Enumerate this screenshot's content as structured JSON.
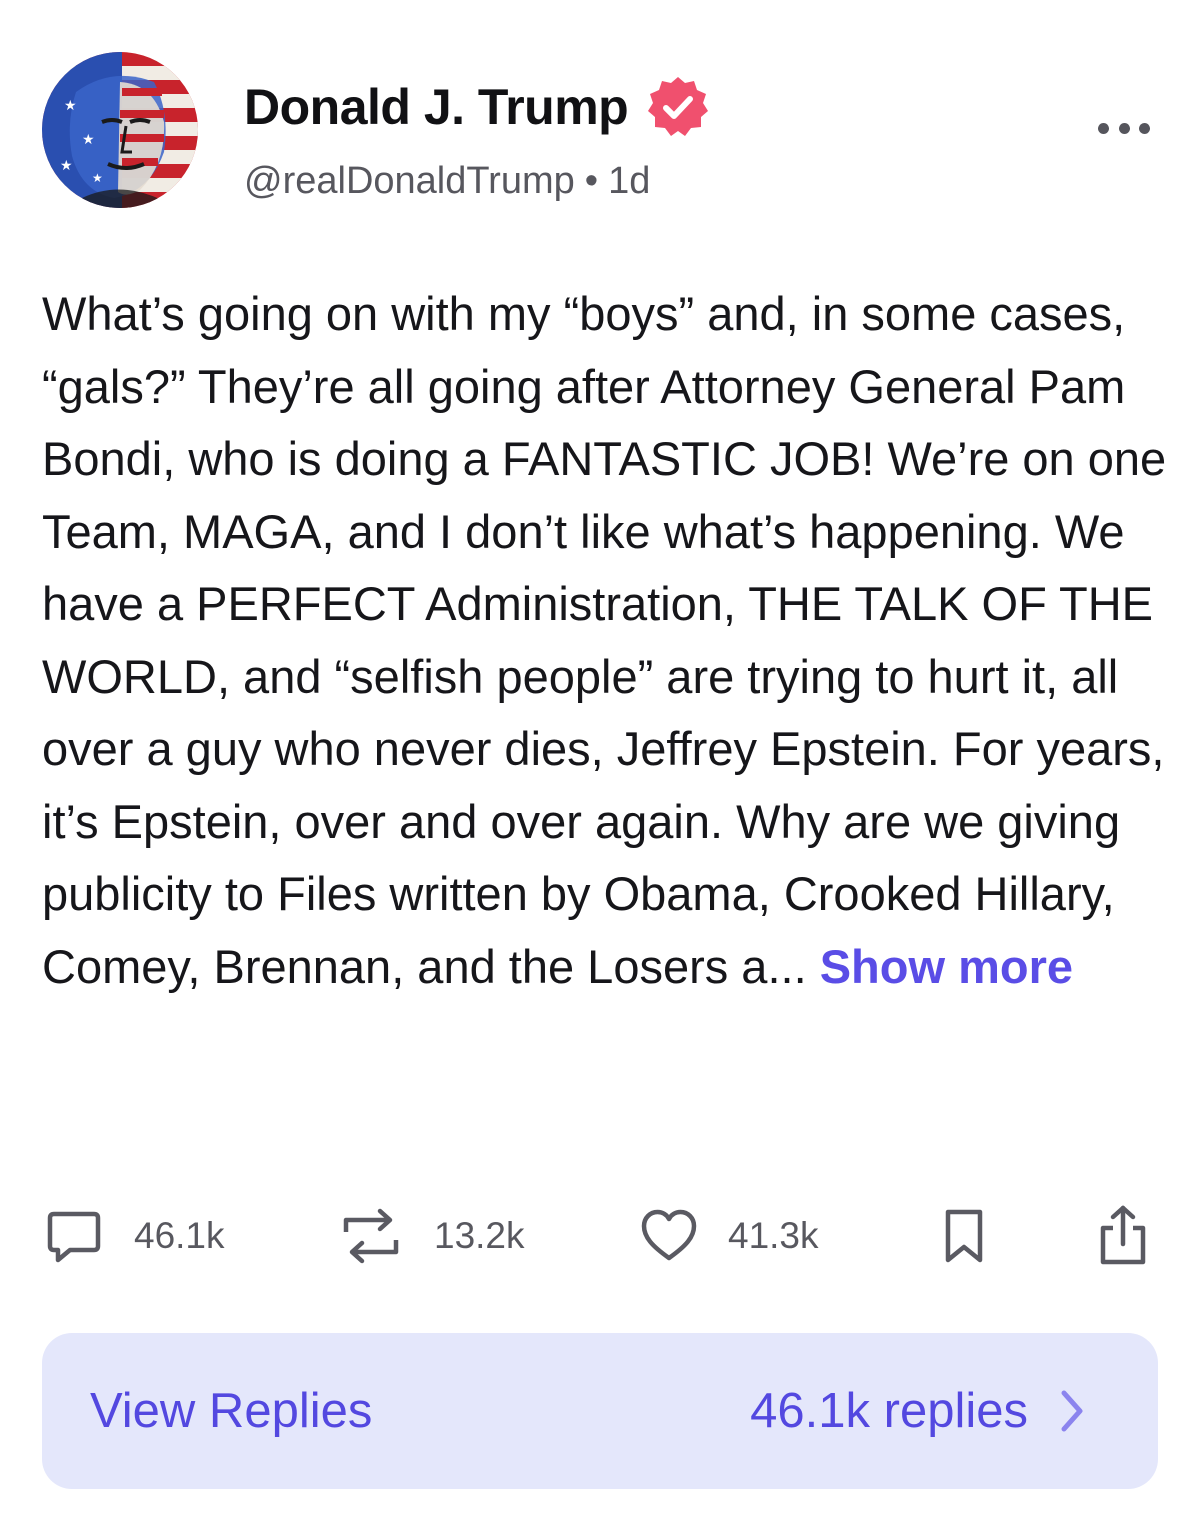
{
  "author": {
    "display_name": "Donald J. Trump",
    "handle": "@realDonaldTrump",
    "separator": "•",
    "time_ago": "1d",
    "verified_badge_color": "#f0506e",
    "avatar_icon": "avatar-portrait-flag"
  },
  "post": {
    "text": "What’s going on with my “boys” and, in some cases, “gals?” They’re all going after Attorney General Pam Bondi, who is doing a FANTASTIC JOB! We’re on one Team, MAGA, and I don’t like what’s happening. We have a PERFECT Administration, THE TALK OF THE WORLD, and “selfish people” are trying to hurt it, all over a guy who never dies, Jeffrey Epstein. For years, it’s Epstein, over and over again. Why are we giving publicity to Files written by Obama, Crooked Hillary, Comey, Brennan, and the Losers a... ",
    "show_more_label": "Show more",
    "accent_color": "#5a4de6"
  },
  "actions": {
    "replies": {
      "icon": "reply-bubble-icon",
      "count": "46.1k"
    },
    "reposts": {
      "icon": "repost-icon",
      "count": "13.2k"
    },
    "likes": {
      "icon": "heart-icon",
      "count": "41.3k"
    },
    "bookmark": {
      "icon": "bookmark-icon"
    },
    "share": {
      "icon": "share-icon"
    }
  },
  "view_replies": {
    "label": "View Replies",
    "count_label": "46.1k replies",
    "background_color": "#e4e7fb"
  }
}
